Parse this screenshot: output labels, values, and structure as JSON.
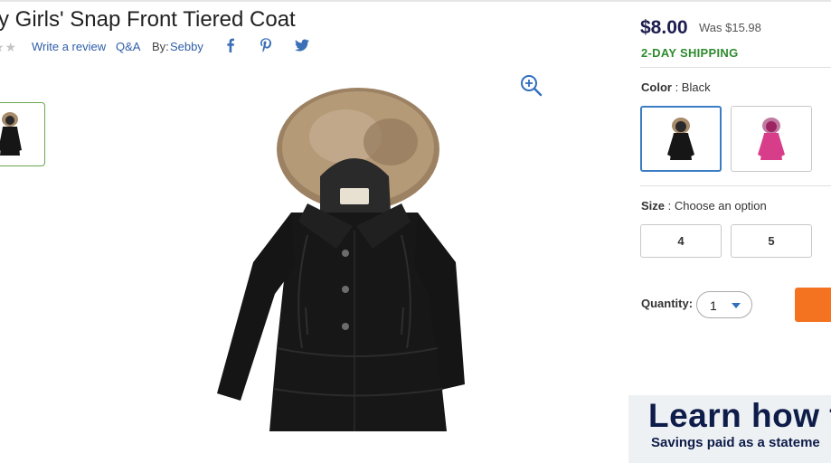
{
  "product": {
    "title": "y Girls' Snap Front Tiered Coat",
    "stars": "★★",
    "write_review": "Write a review",
    "qa": "Q&A",
    "by_label": "By:",
    "brand": "Sebby",
    "social": [
      "facebook-icon",
      "pinterest-icon",
      "twitter-icon"
    ]
  },
  "gallery": {
    "thumbnails": [
      "black-coat-thumbnail"
    ],
    "zoom_icon": "zoom-in-icon"
  },
  "pricing": {
    "price": "$8.00",
    "was": "Was $15.98",
    "shipping": "2-DAY SHIPPING"
  },
  "options": {
    "color_label": "Color",
    "color_separator": " : ",
    "color_value": "Black",
    "color_swatches": [
      "black",
      "pink"
    ],
    "size_label": "Size",
    "size_separator": " : ",
    "size_value": "Choose an option",
    "sizes": [
      "4",
      "5"
    ]
  },
  "quantity": {
    "label": "Quantity:",
    "value": "1"
  },
  "promo": {
    "title": "Learn how to",
    "subtitle": "Savings paid as a stateme"
  },
  "colors": {
    "price": "#1d1d4f",
    "shipping": "#2e8b2e",
    "link": "#2f5fa8",
    "add_to_cart": "#f47321",
    "selected_border": "#3b7dc4",
    "coat_black": "#161616",
    "coat_pink": "#d83d8a"
  }
}
